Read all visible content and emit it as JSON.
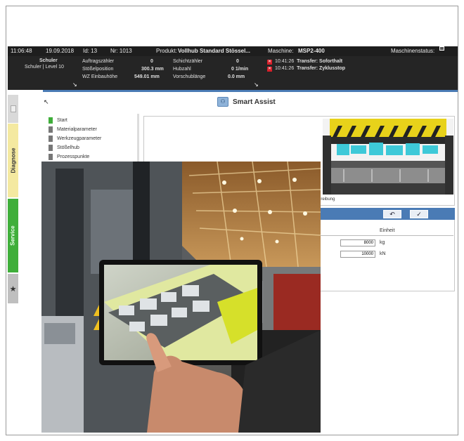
{
  "topbar": {
    "time": "11:06:48",
    "date": "19.09.2018",
    "id": "Id: 13",
    "nr": "Nr: 1013",
    "produkt_label": "Produkt:",
    "produkt_value": "Vollhub Standard Stössel...",
    "maschine_label": "Maschine:",
    "maschine_value": "MSP2-400",
    "status_label": "Maschinenstatus:"
  },
  "user": {
    "name": "Schuler",
    "role": "Schuler | Level 10"
  },
  "counters": [
    {
      "label": "Auftragszähler",
      "value": "0"
    },
    {
      "label": "Stößelposition",
      "value": "300.3 mm"
    },
    {
      "label": "WZ Einbauhöhe",
      "value": "549.01 mm"
    }
  ],
  "counters2": [
    {
      "label": "Schichtzähler",
      "value": "0"
    },
    {
      "label": "Hubzahl",
      "value": "0 1/min"
    },
    {
      "label": "Vorschublänge",
      "value": "0.0 mm"
    }
  ],
  "messages": [
    {
      "time": "10:41:26",
      "text": "Transfer: Soforthalt"
    },
    {
      "time": "10:41:26",
      "text": "Transfer: Zyklusstop"
    }
  ],
  "sidebar": {
    "diagnose": "Diagnose",
    "service": "Service",
    "star": "★"
  },
  "page": {
    "title": "Smart Assist"
  },
  "steps": [
    {
      "label": "Start",
      "active": true
    },
    {
      "label": "Materialparameter",
      "active": false
    },
    {
      "label": "Werkzeugparameter",
      "active": false
    },
    {
      "label": "Stößelhub",
      "active": false
    },
    {
      "label": "Prozesspunkte",
      "active": false
    }
  ],
  "image_caption": "schreibung",
  "buttons": {
    "back": "↶",
    "confirm": "✓"
  },
  "form": {
    "einheit": "Einheit",
    "rows": [
      {
        "value": "8000",
        "unit": "kg"
      },
      {
        "value": "10000",
        "unit": "kN"
      }
    ]
  },
  "colors": {
    "accent": "#4a7bb5",
    "header_bg": "#1e1e1e",
    "diagnose_tab": "#f4e9a0",
    "service_tab": "#3fae3a",
    "active_step": "#3fae3a",
    "error": "#e0202a"
  }
}
